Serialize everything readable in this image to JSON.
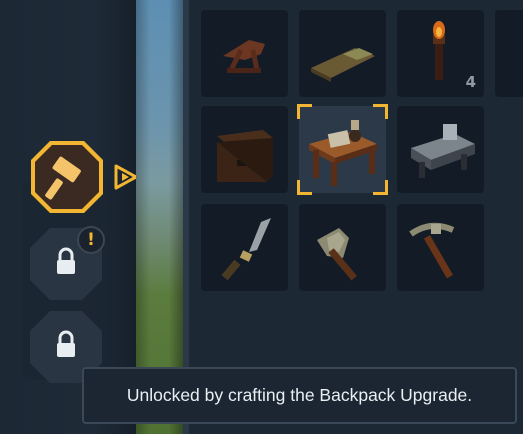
{
  "categories": [
    {
      "name": "crafting-hammer",
      "state": "selected",
      "icon": "hammer-icon"
    },
    {
      "name": "locked-category-1",
      "state": "locked",
      "icon": "lock-icon",
      "alert": "!"
    },
    {
      "name": "locked-category-2",
      "state": "locked",
      "icon": "lock-icon"
    }
  ],
  "items": [
    {
      "icon": "crossbow-icon",
      "count": ""
    },
    {
      "icon": "plank-icon",
      "count": ""
    },
    {
      "icon": "torch-icon",
      "count": "4"
    },
    {
      "icon": "chest-icon",
      "count": ""
    },
    {
      "icon": "workbench-icon",
      "count": "",
      "selected": true
    },
    {
      "icon": "anvil-icon",
      "count": ""
    },
    {
      "icon": "knife-icon",
      "count": ""
    },
    {
      "icon": "stone-axe-icon",
      "count": ""
    },
    {
      "icon": "pickaxe-icon",
      "count": ""
    }
  ],
  "tooltip": {
    "text": "Unlocked by crafting the Backpack Upgrade."
  },
  "colors": {
    "accent": "#f2b632",
    "panel": "#1d2835",
    "slot": "#131c26"
  }
}
